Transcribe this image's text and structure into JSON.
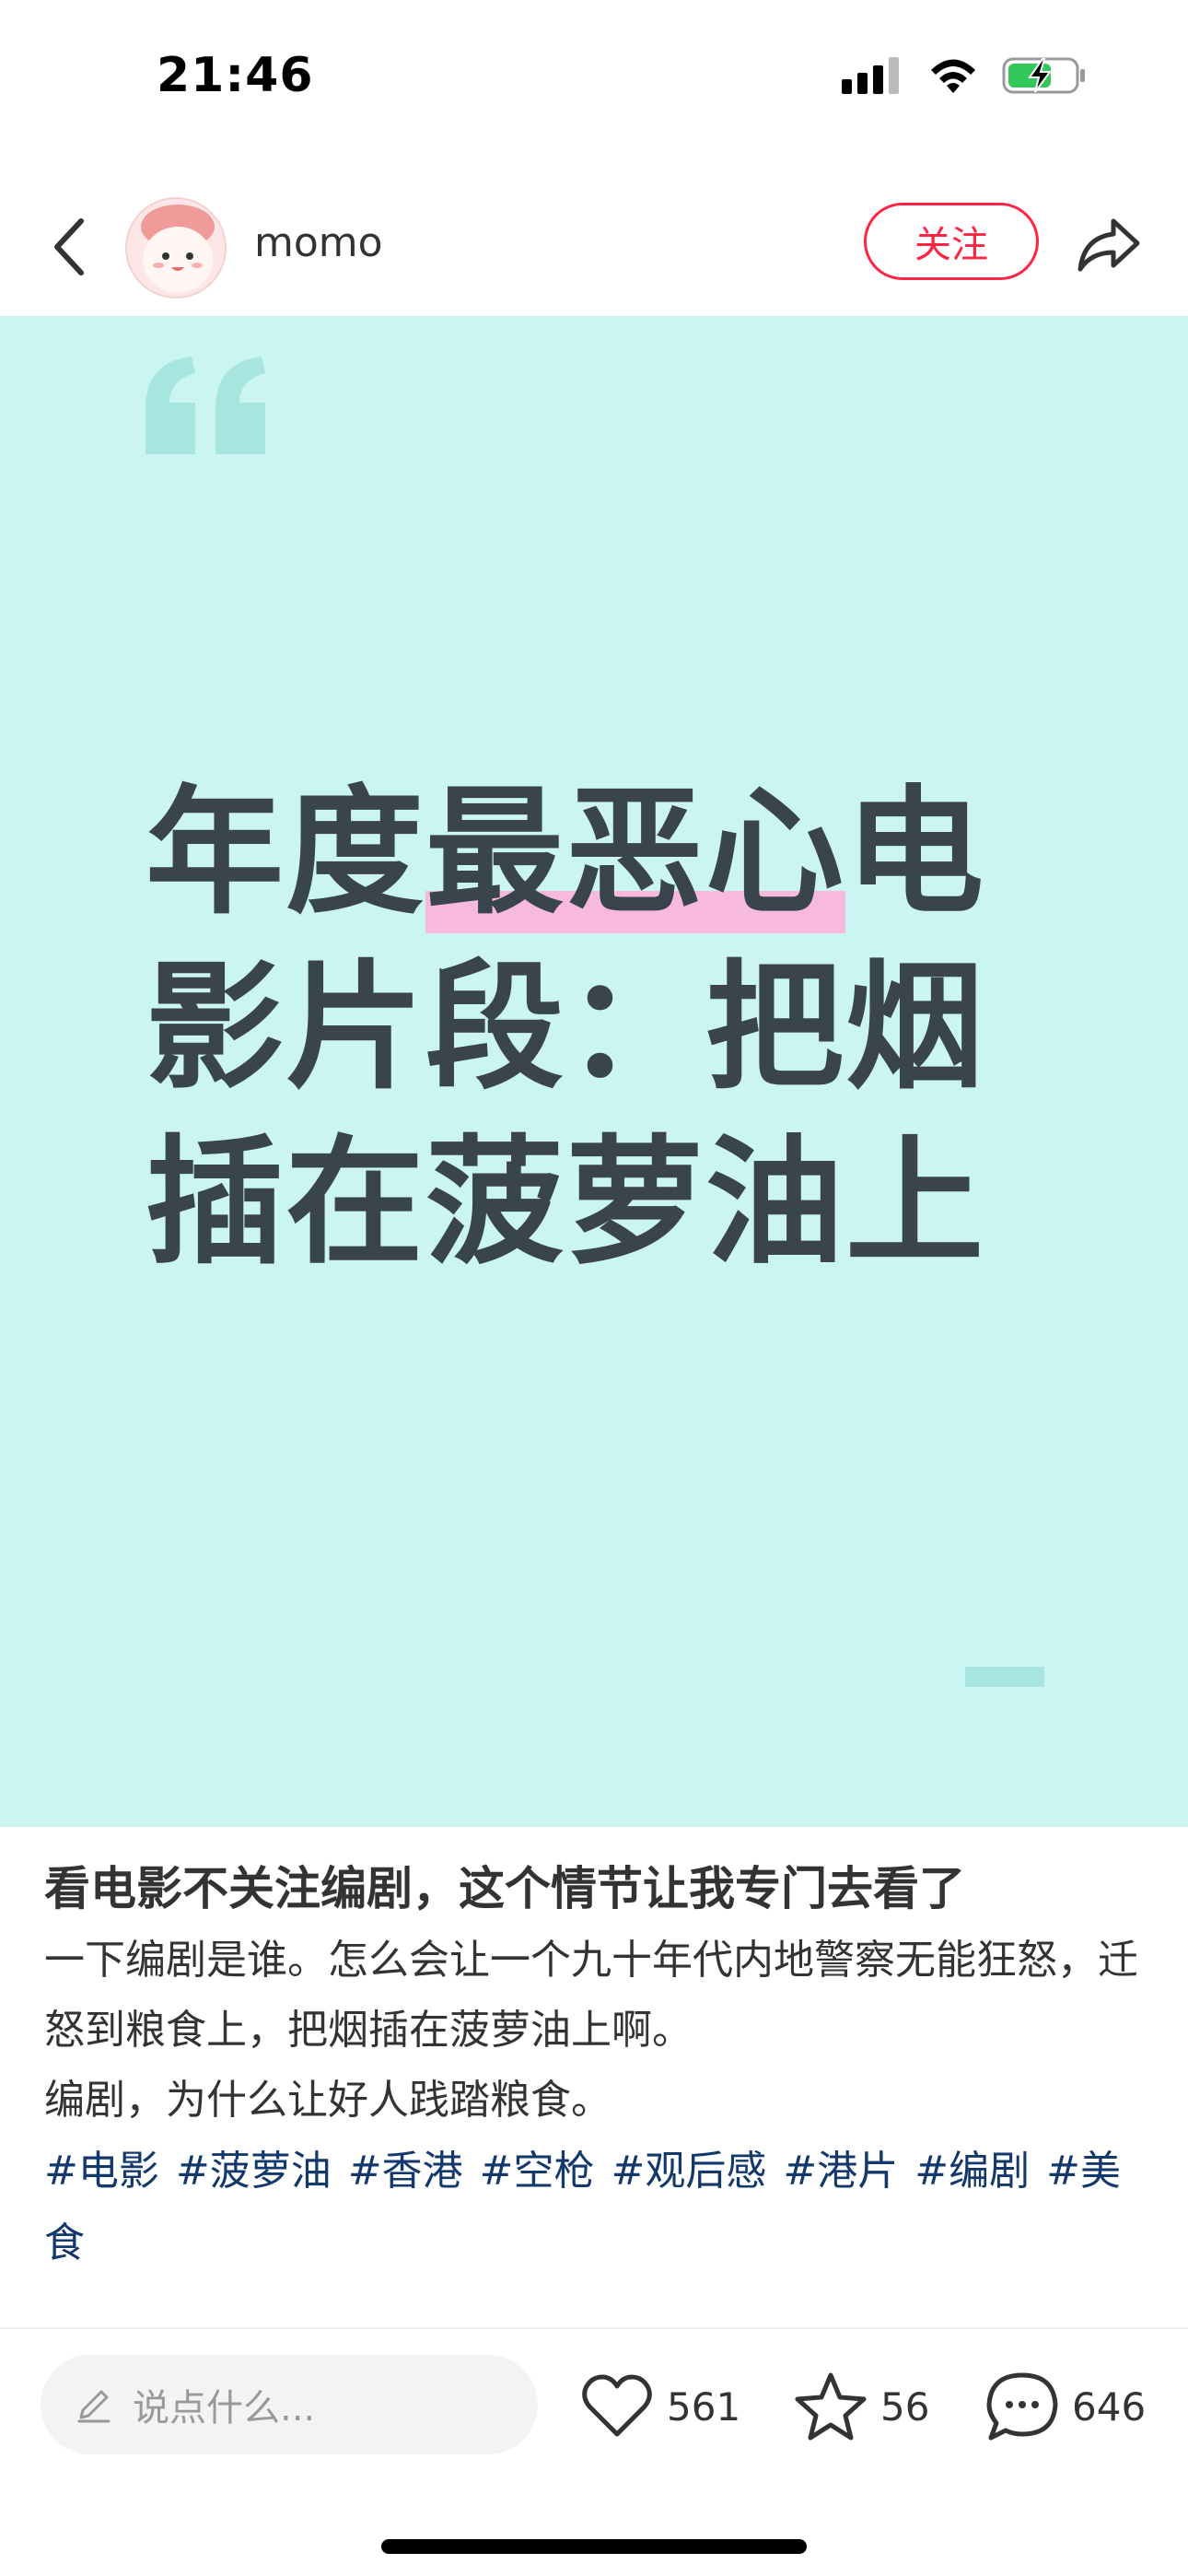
{
  "status_bar": {
    "time": "21:46",
    "icons": [
      "signal-icon",
      "wifi-icon",
      "battery-charging-icon"
    ]
  },
  "header": {
    "username": "momo",
    "follow_label": "关注",
    "icons": [
      "back-icon",
      "avatar",
      "share-icon"
    ]
  },
  "cover": {
    "background": "#cbf5f3",
    "title_prefix": "年度",
    "title_highlight": "最恶心",
    "title_suffix": "电影片段：把烟插在菠萝油上",
    "highlight_color": "#f8b9df"
  },
  "post": {
    "title": "看电影不关注编剧，这个情节让我专门去看了",
    "body_line1": "一下编剧是谁。怎么会让一个九十年代内地警察无能狂怒，迁怒到粮食上，把烟插在菠萝油上啊。",
    "body_line2": "编剧，为什么让好人践踏粮食。",
    "tags": [
      "#电影",
      "#菠萝油",
      "#香港",
      "#空枪",
      "#观后感",
      "#港片",
      "#编剧",
      "#美食"
    ]
  },
  "bottom_bar": {
    "comment_placeholder": "说点什么...",
    "likes": "561",
    "favorites": "56",
    "comments": "646"
  },
  "colors": {
    "accent": "#ff2442",
    "tag": "#13386c"
  }
}
